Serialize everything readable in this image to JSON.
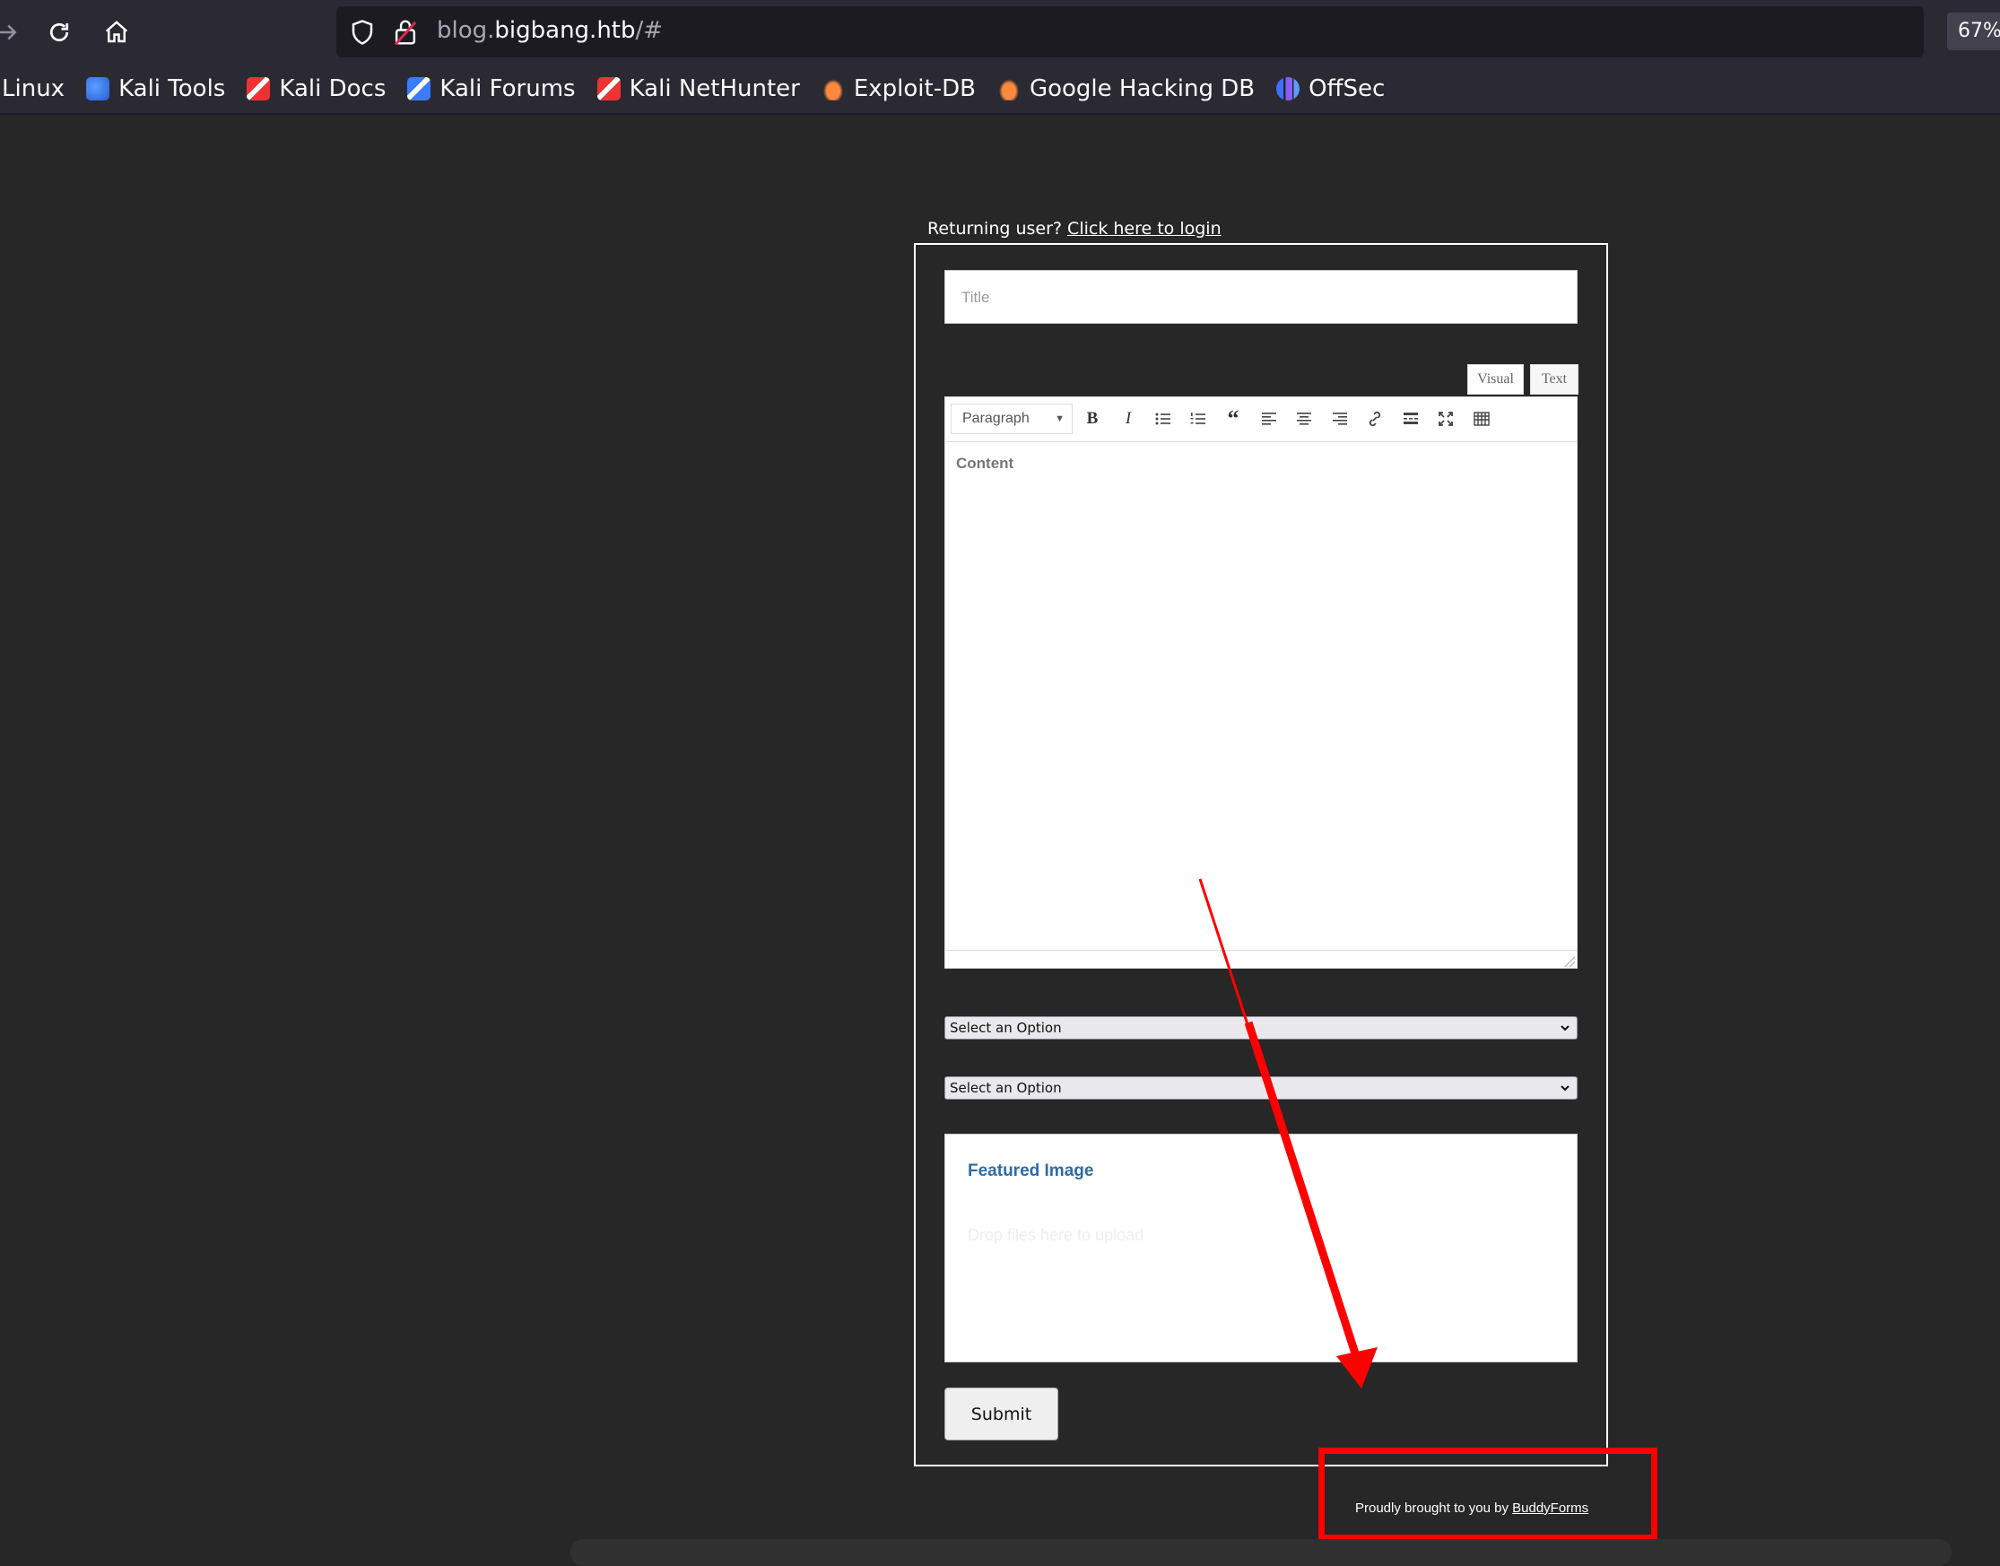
{
  "browser": {
    "url_prefix": "blog.",
    "url_host": "bigbang.htb",
    "url_suffix": "/#",
    "zoom": "67%",
    "bookmarks": [
      {
        "label": "Linux"
      },
      {
        "label": "Kali Tools",
        "icon": "kali-tools-icon"
      },
      {
        "label": "Kali Docs",
        "icon": "kali-docs-icon"
      },
      {
        "label": "Kali Forums",
        "icon": "kali-forums-icon"
      },
      {
        "label": "Kali NetHunter",
        "icon": "kali-nethunter-icon"
      },
      {
        "label": "Exploit-DB",
        "icon": "exploit-db-icon"
      },
      {
        "label": "Google Hacking DB",
        "icon": "google-hacking-db-icon"
      },
      {
        "label": "OffSec",
        "icon": "offsec-icon"
      }
    ]
  },
  "page": {
    "returning_text": "Returning user?",
    "login_link": "Click here to login",
    "title_placeholder": "Title",
    "tab_visual": "Visual",
    "tab_text": "Text",
    "format_select": "Paragraph",
    "content_placeholder": "Content",
    "select_1": "Select an Option",
    "select_2": "Select an Option",
    "featured_title": "Featured Image",
    "featured_hint": "Drop files here to upload",
    "submit_label": "Submit",
    "powered_text": "Proudly brought to you by",
    "powered_link": "BuddyForms"
  },
  "colors": {
    "page_bg": "#272727",
    "annotation": "#ff0000",
    "featured_title": "#2e6ba7"
  }
}
